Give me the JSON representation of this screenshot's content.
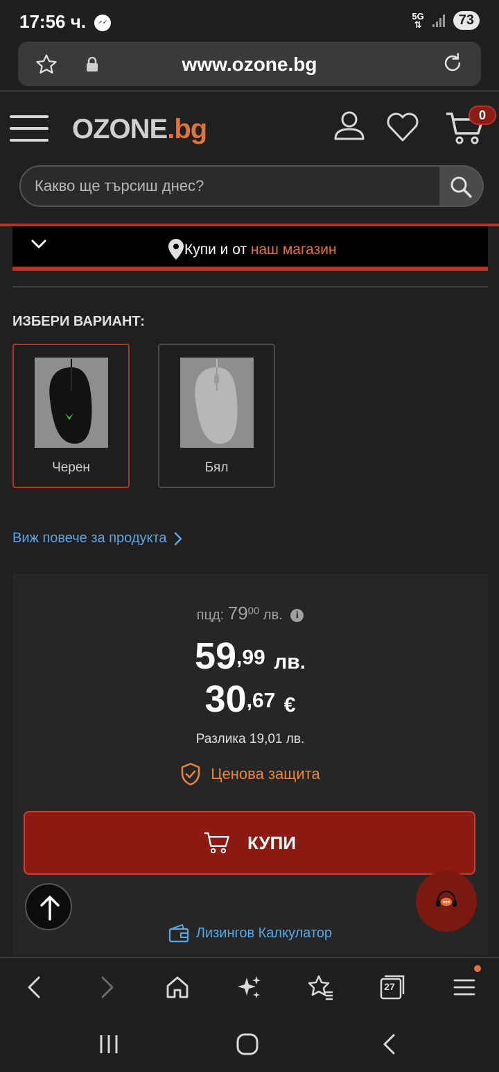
{
  "status_bar": {
    "time": "17:56 ч.",
    "network_top": "5G",
    "battery": "73"
  },
  "browser": {
    "url": "www.ozone.bg",
    "tabs_count": "27"
  },
  "header": {
    "logo_main": "OZONE",
    "logo_suffix": ".bg",
    "cart_count": "0",
    "search_placeholder": "Какво ще търсиш днес?"
  },
  "store_bar": {
    "text_prefix": "Купи и от ",
    "text_highlight": "наш магазин"
  },
  "variants": {
    "title": "ИЗБЕРИ ВАРИАНТ:",
    "items": [
      {
        "label": "Черен",
        "selected": true
      },
      {
        "label": "Бял",
        "selected": false
      }
    ]
  },
  "more_link": "Виж повече за продукта",
  "pricing": {
    "rrp_label": "пцд:",
    "rrp_int": "79",
    "rrp_dec": "00",
    "rrp_currency": "лв.",
    "price_int": "59",
    "price_dec": ",99",
    "price_currency": "лв.",
    "eur_int": "30",
    "eur_dec": ",67",
    "eur_currency": "€",
    "difference": "Разлика 19,01 лв.",
    "protection": "Ценова защита",
    "buy_label": "КУПИ",
    "leasing": "Лизингов Калкулатор"
  },
  "colors": {
    "accent": "#e8703a",
    "brand_red": "#8a1a12",
    "link_blue": "#5aa7e6"
  }
}
